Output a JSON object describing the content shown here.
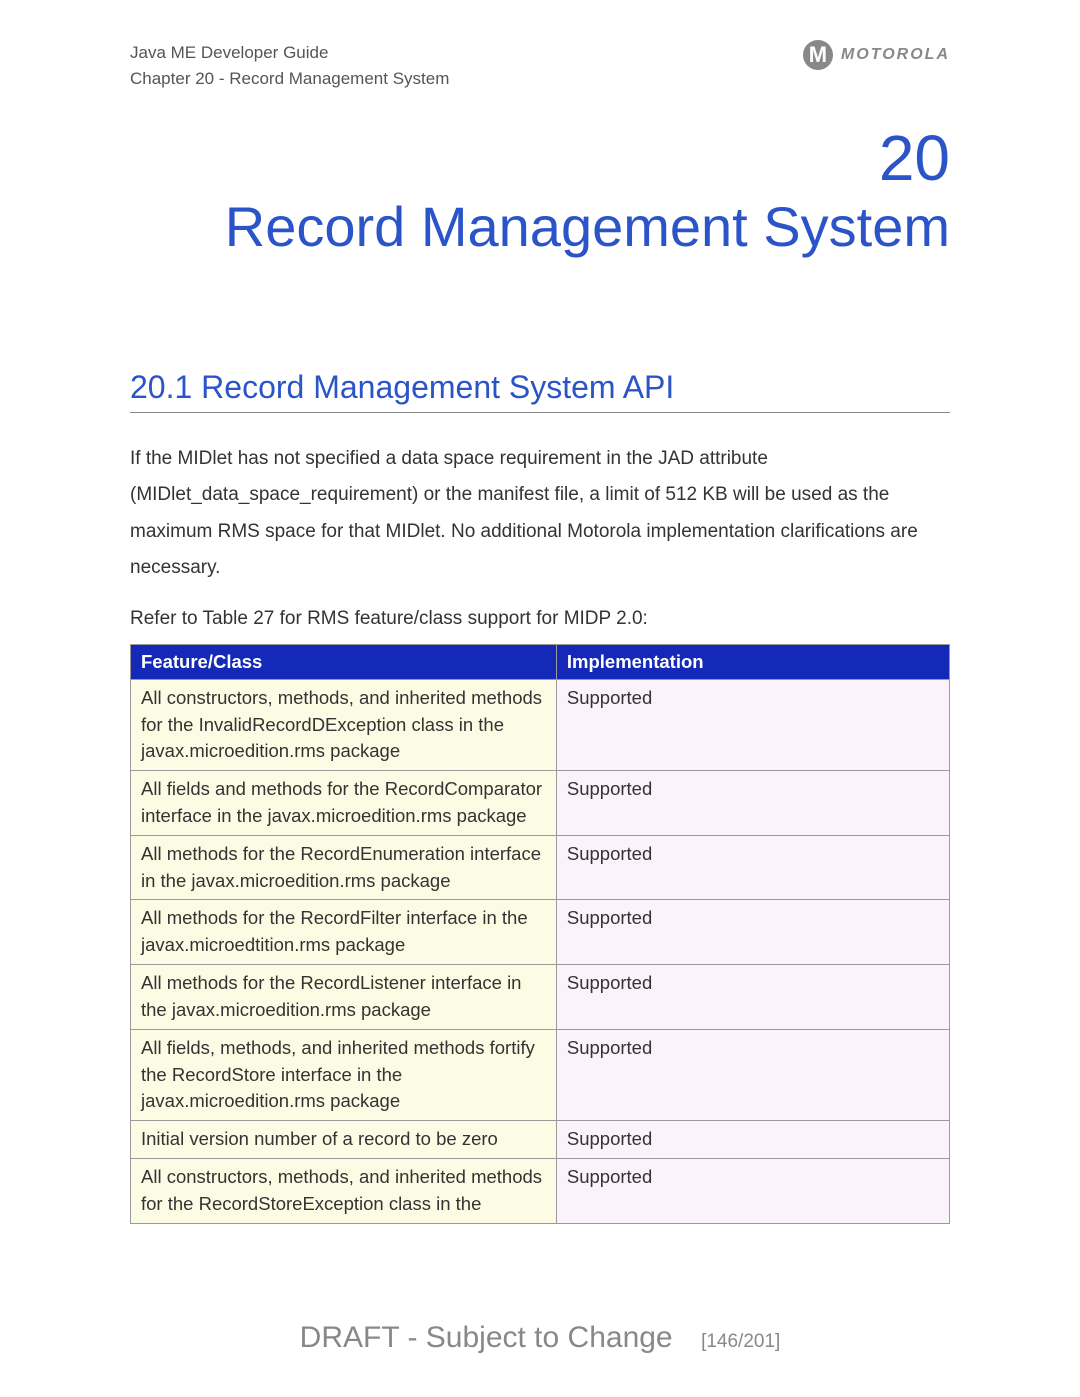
{
  "header": {
    "line1": "Java ME Developer Guide",
    "line2": "Chapter 20 - Record Management System",
    "brand": "MOTOROLA",
    "brand_letter": "M"
  },
  "chapter": {
    "number": "20",
    "title": "Record Management System"
  },
  "section": {
    "heading": "20.1 Record Management System API",
    "paragraph": "If the MIDlet has not specified a data space requirement in the JAD attribute (MIDlet_data_space_requirement) or the manifest file, a limit of 512 KB will be used as the maximum RMS space for that MIDlet. No additional Motorola implementation clarifications are necessary.",
    "refer": "Refer to Table 27 for RMS feature/class support for MIDP 2.0:"
  },
  "table": {
    "headers": {
      "feature": "Feature/Class",
      "impl": "Implementation"
    },
    "rows": [
      {
        "feature": "All constructors, methods, and inherited methods for the InvalidRecordDException class in the javax.microedition.rms package",
        "impl": "Supported"
      },
      {
        "feature": "All fields and methods for the RecordComparator interface in the javax.microedition.rms package",
        "impl": "Supported"
      },
      {
        "feature": "All methods for the RecordEnumeration interface in the javax.microedition.rms package",
        "impl": "Supported"
      },
      {
        "feature": "All methods for the RecordFilter interface in the javax.microedtition.rms package",
        "impl": "Supported"
      },
      {
        "feature": "All methods for the RecordListener interface in the javax.microedition.rms package",
        "impl": "Supported"
      },
      {
        "feature": "All fields, methods, and inherited methods fortify the RecordStore interface in the javax.microedition.rms package",
        "impl": "Supported"
      },
      {
        "feature": "Initial version number of a record to be zero",
        "impl": "Supported"
      },
      {
        "feature": "All constructors, methods, and inherited methods for the RecordStoreException class in the",
        "impl": "Supported"
      }
    ]
  },
  "footer": {
    "status": "DRAFT - Subject to Change",
    "page": "[146/201]"
  }
}
